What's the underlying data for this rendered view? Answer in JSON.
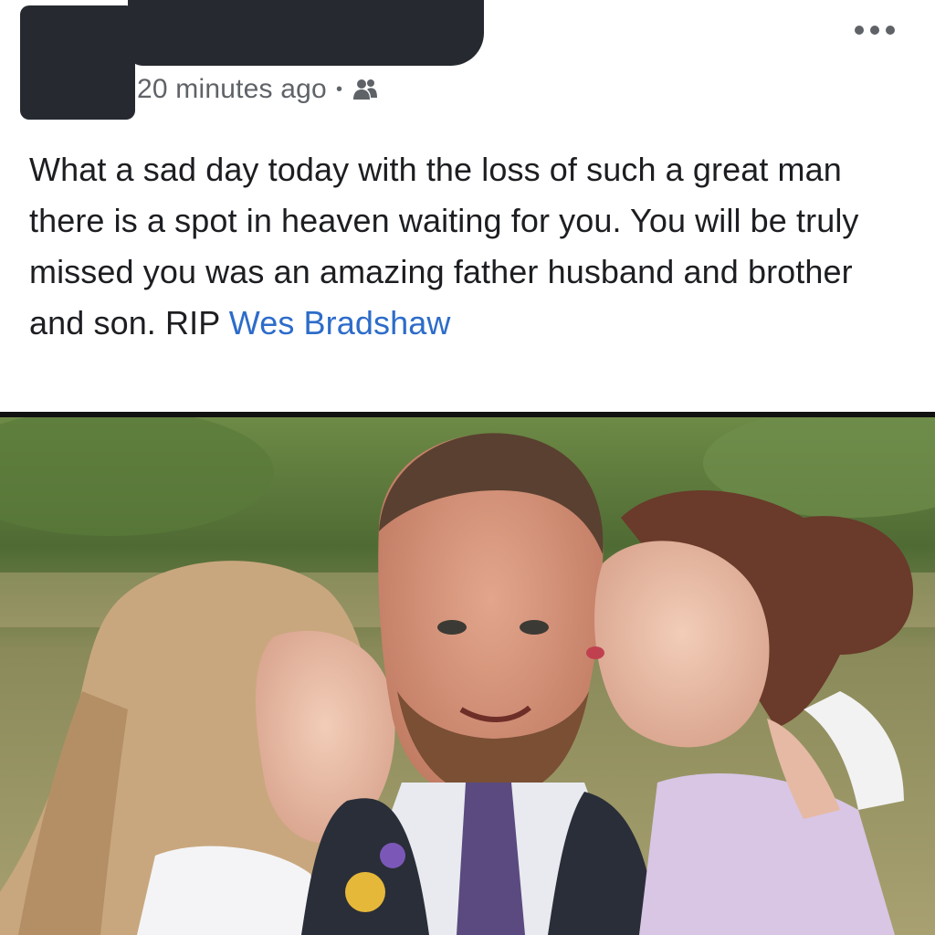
{
  "post": {
    "timestamp": "20 minutes ago",
    "separator": "•",
    "audience_icon": "friends-icon",
    "more_icon": "more-options-icon",
    "text": "What a sad day today with the loss of such a great man there is a spot in heaven waiting for you. You will be truly missed you was an amazing father husband and brother and son. RIP ",
    "mention": "Wes Bradshaw",
    "photo_icon": "photo"
  },
  "colors": {
    "mention": "#2d6cc9",
    "meta": "#5f6368",
    "text": "#1c1e21",
    "redaction": "#262a30"
  }
}
